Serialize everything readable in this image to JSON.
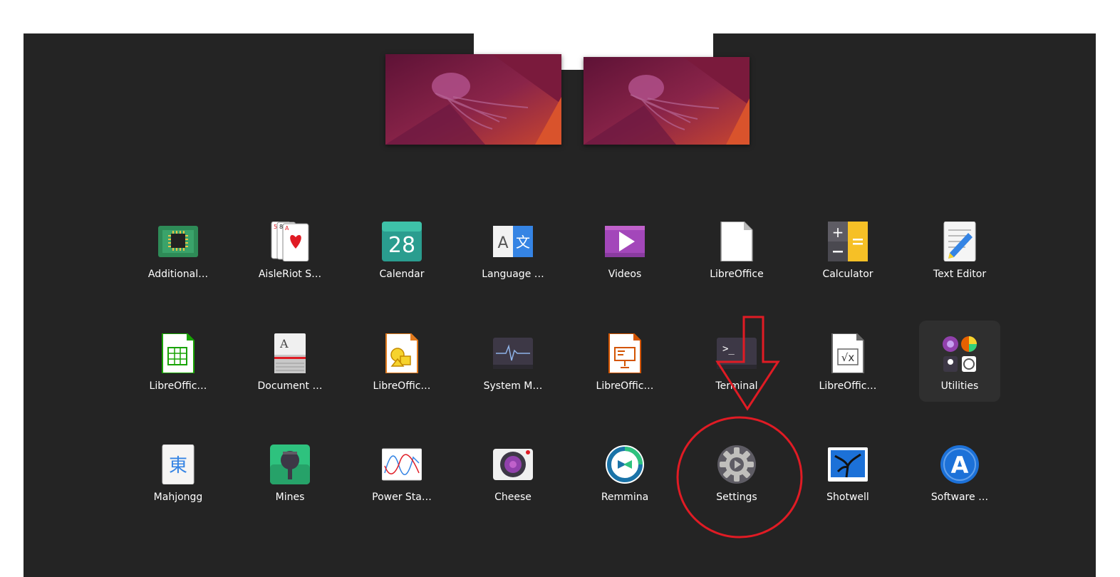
{
  "overview": {
    "workspaces": [
      "workspace-1",
      "workspace-2"
    ],
    "accent_color": "#e01b24",
    "background_color": "#242424"
  },
  "apps": [
    {
      "label": "Additional…",
      "icon": "chip-icon"
    },
    {
      "label": "AisleRiot S…",
      "icon": "playing-cards-icon"
    },
    {
      "label": "Calendar",
      "icon": "calendar-icon",
      "icon_text": "28"
    },
    {
      "label": "Language …",
      "icon": "language-icon",
      "icon_text_a": "A",
      "icon_text_b": "文"
    },
    {
      "label": "Videos",
      "icon": "videos-play-icon"
    },
    {
      "label": "LibreOffice",
      "icon": "libreoffice-doc-icon"
    },
    {
      "label": "Calculator",
      "icon": "calculator-icon"
    },
    {
      "label": "Text Editor",
      "icon": "text-editor-icon"
    },
    {
      "label": "LibreOffic…",
      "icon": "libreoffice-calc-icon"
    },
    {
      "label": "Document …",
      "icon": "document-viewer-icon",
      "icon_text": "A"
    },
    {
      "label": "LibreOffic…",
      "icon": "libreoffice-draw-icon"
    },
    {
      "label": "System M…",
      "icon": "system-monitor-icon"
    },
    {
      "label": "LibreOffic…",
      "icon": "libreoffice-impress-icon"
    },
    {
      "label": "Terminal",
      "icon": "terminal-icon",
      "icon_text": ">_"
    },
    {
      "label": "LibreOffic…",
      "icon": "libreoffice-math-icon",
      "icon_text": "√x"
    },
    {
      "label": "Utilities",
      "icon": "utilities-folder-icon"
    },
    {
      "label": "Mahjongg",
      "icon": "mahjongg-icon",
      "icon_text": "東"
    },
    {
      "label": "Mines",
      "icon": "mines-icon"
    },
    {
      "label": "Power Sta…",
      "icon": "power-statistics-icon"
    },
    {
      "label": "Cheese",
      "icon": "cheese-camera-icon"
    },
    {
      "label": "Remmina",
      "icon": "remmina-icon"
    },
    {
      "label": "Settings",
      "icon": "settings-gear-icon"
    },
    {
      "label": "Shotwell",
      "icon": "shotwell-icon"
    },
    {
      "label": "Software …",
      "icon": "software-store-icon",
      "icon_text": "A"
    }
  ],
  "annotation": {
    "color": "#e01b24",
    "target": "Settings"
  }
}
